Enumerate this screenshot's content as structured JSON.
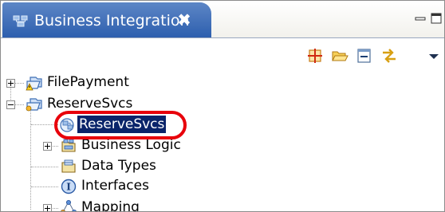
{
  "view": {
    "title": "Business Integration",
    "close_glyph": "✖",
    "icons": {
      "view": "business-integration-view-icon",
      "minimize": "minimize-icon",
      "maximize": "maximize-icon"
    }
  },
  "toolbar": {
    "buttons": [
      {
        "name": "new-module-icon"
      },
      {
        "name": "open-folder-icon"
      },
      {
        "name": "collapse-all-icon"
      },
      {
        "name": "link-with-editor-icon"
      },
      {
        "name": "view-menu-icon"
      }
    ]
  },
  "tree": {
    "items": [
      {
        "label": "FilePayment",
        "icon": "warning-library-icon",
        "expander": "collapsed",
        "selected": false
      },
      {
        "label": "ReserveSvcs",
        "icon": "module-icon",
        "expander": "expanded",
        "selected": false
      },
      {
        "label": "ReserveSvcs",
        "icon": "assembly-diagram-icon",
        "expander": "none",
        "selected": true
      },
      {
        "label": "Business Logic",
        "icon": "business-logic-icon",
        "expander": "collapsed",
        "selected": false
      },
      {
        "label": "Data Types",
        "icon": "data-types-icon",
        "expander": "none",
        "selected": false
      },
      {
        "label": "Interfaces",
        "icon": "interface-icon",
        "expander": "none",
        "selected": false
      },
      {
        "label": "Mapping",
        "icon": "mapping-icon",
        "expander": "collapsed",
        "selected": false
      }
    ]
  },
  "colors": {
    "tab_active": "#2d5fae",
    "selection": "#0a246a",
    "highlight_ring": "#e8000b"
  }
}
